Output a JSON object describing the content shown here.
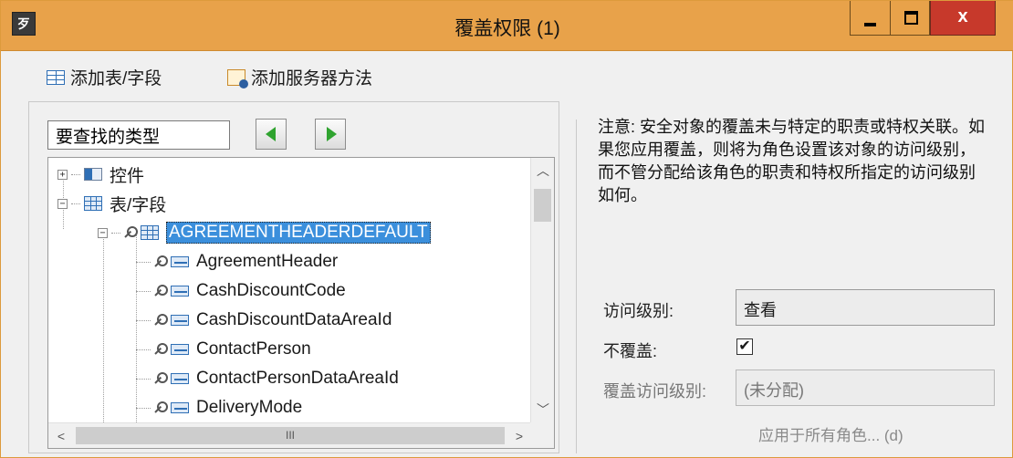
{
  "window": {
    "title": "覆盖权限 (1)",
    "app_icon": "歹",
    "close_label": "x"
  },
  "toolbar": {
    "add_table": "添加表/字段",
    "add_method": "添加服务器方法"
  },
  "search": {
    "value": "要查找的类型"
  },
  "tree": {
    "items": [
      {
        "label": "控件",
        "expander": "+",
        "icon": "control-icon"
      },
      {
        "label": "表/字段",
        "expander": "−",
        "icon": "table-icon"
      },
      {
        "label": "AGREEMENTHEADERDEFAULT",
        "expander": "−",
        "icon": "table-key-icon",
        "selected": true
      },
      {
        "label": "AgreementHeader",
        "icon": "field-key-icon"
      },
      {
        "label": "CashDiscountCode",
        "icon": "field-key-icon"
      },
      {
        "label": "CashDiscountDataAreaId",
        "icon": "field-key-icon"
      },
      {
        "label": "ContactPerson",
        "icon": "field-key-icon"
      },
      {
        "label": "ContactPersonDataAreaId",
        "icon": "field-key-icon"
      },
      {
        "label": "DeliveryMode",
        "icon": "field-key-icon"
      }
    ],
    "hscroll_grip": "III"
  },
  "note": "注意: 安全对象的覆盖未与特定的职责或特权关联。如果您应用覆盖，则将为角色设置该对象的访问级别，而不管分配给该角色的职责和特权所指定的访问级别如何。",
  "form": {
    "access_level_label": "访问级别:",
    "access_level_value": "查看",
    "no_override_label": "不覆盖:",
    "no_override_checked": true,
    "override_level_label": "覆盖访问级别:",
    "override_level_value": "(未分配)",
    "apply_all": "应用于所有角色... (d)"
  }
}
